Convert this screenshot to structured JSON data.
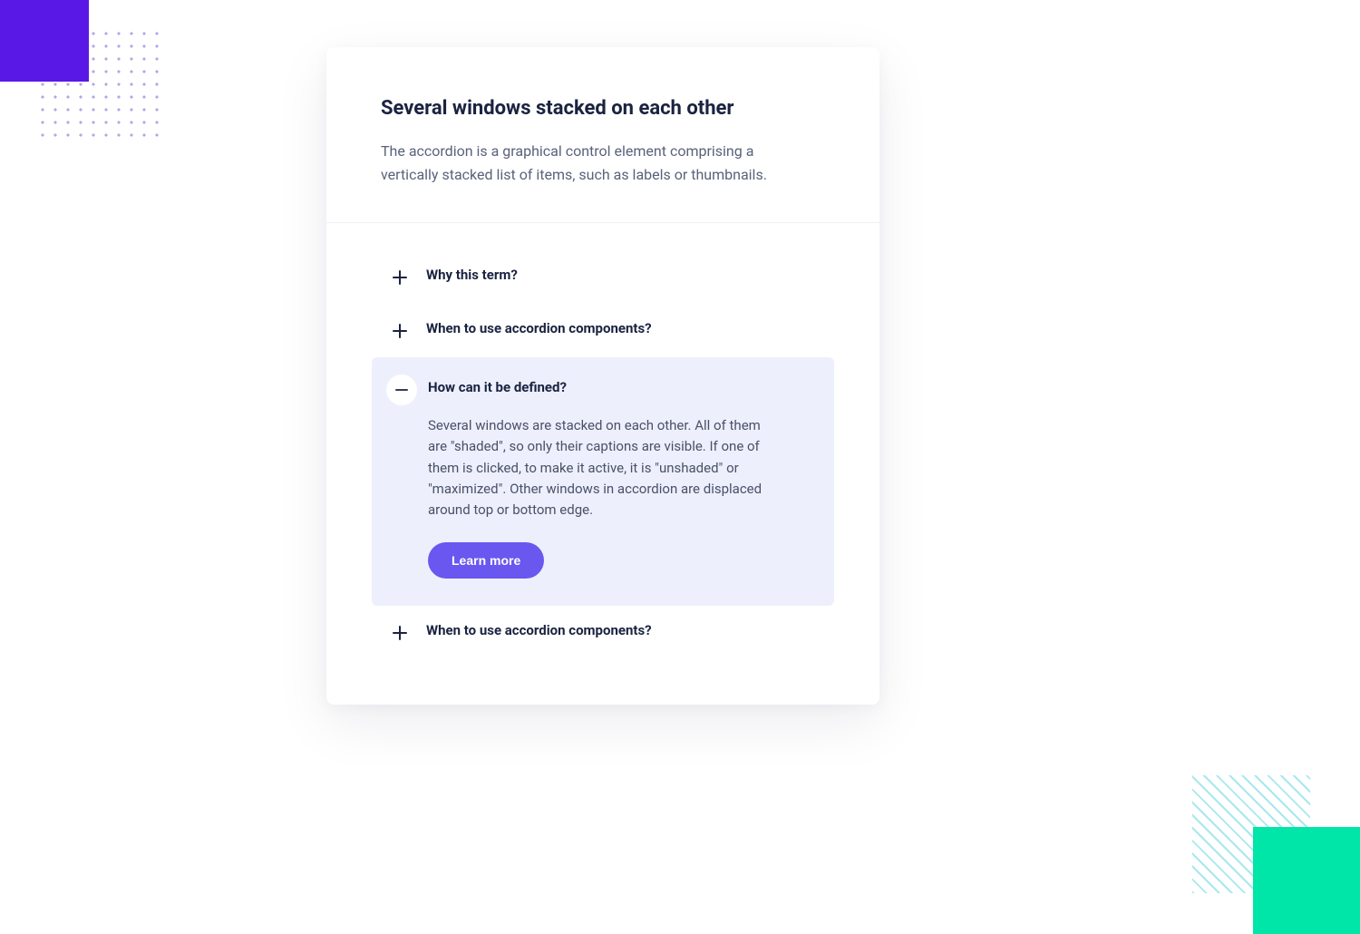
{
  "card": {
    "title": "Several windows stacked on each other",
    "description": "The accordion is a graphical control element comprising a vertically stacked list of items, such as labels or thumbnails."
  },
  "accordion": {
    "items": [
      {
        "title": "Why this term?",
        "open": false
      },
      {
        "title": "When to use accordion components?",
        "open": false
      },
      {
        "title": "How can it be defined?",
        "open": true,
        "body": "Several windows are stacked on each other. All of them are \"shaded\", so only their captions are visible. If one of them is clicked, to make it active, it is \"unshaded\" or \"maximized\". Other windows in accordion are displaced around top or bottom edge.",
        "cta": "Learn more"
      },
      {
        "title": "When to use accordion components?",
        "open": false
      }
    ]
  }
}
